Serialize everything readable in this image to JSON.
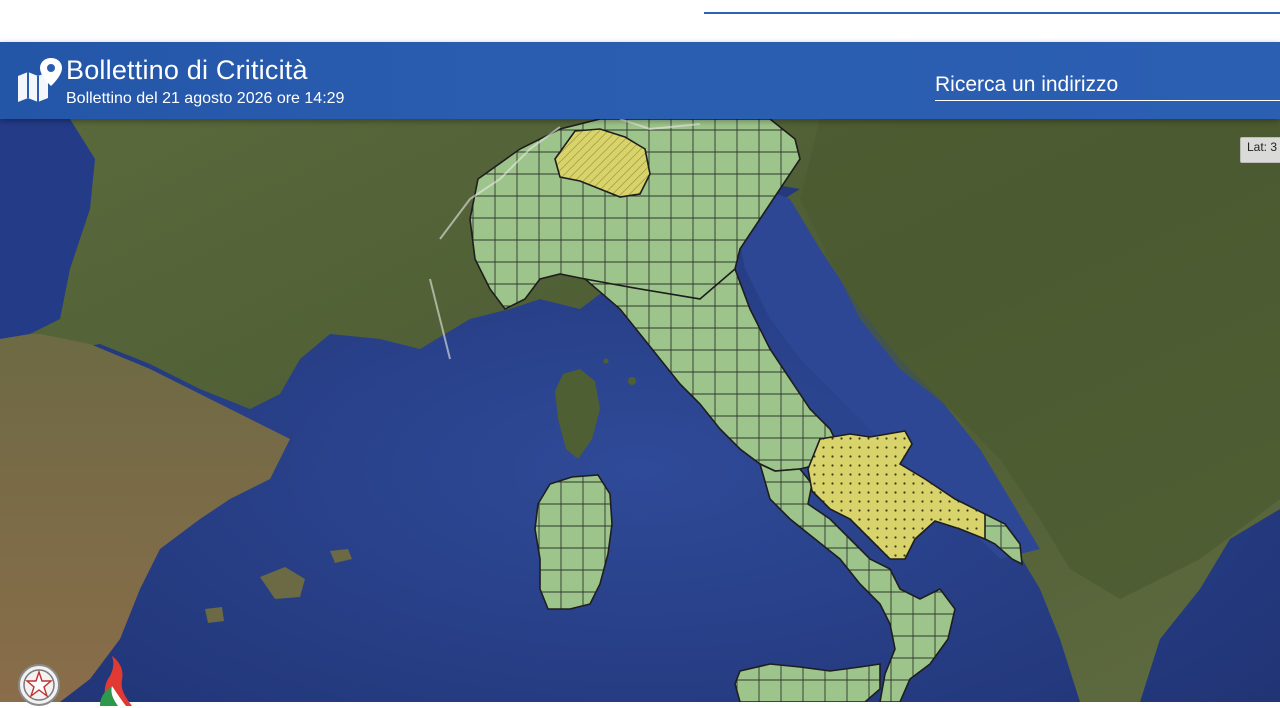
{
  "app": {
    "title": "Bollettino di Criticità",
    "subtitle": "Bollettino del 21 agosto 2026 ore 14:29"
  },
  "search": {
    "placeholder": "Ricerca un indirizzo"
  },
  "map": {
    "coord_readout": "Lat: 3",
    "colors": {
      "green_zone": "#9dc48a",
      "yellow_zone": "#d8d46b",
      "border": "#1e1e1e",
      "sea": "#2a3f86",
      "land": "#52603a"
    }
  },
  "icons": {
    "logo": "map-marker-icon",
    "emblem": "italian-republic-emblem-icon",
    "flag": "protezione-civile-logo-icon"
  }
}
